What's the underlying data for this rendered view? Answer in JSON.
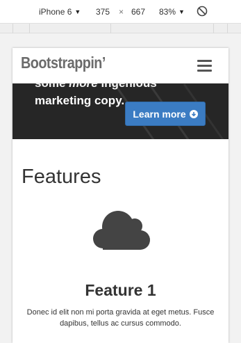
{
  "devtools": {
    "device": "iPhone 6",
    "width": "375",
    "separator": "×",
    "height": "667",
    "zoom": "83%"
  },
  "navbar": {
    "brand": "Bootstrappin’"
  },
  "hero": {
    "line1_start": "some ",
    "line1_em": "more",
    "line1_end": " ingenious",
    "line2": "marketing copy.",
    "button_label": "Learn more"
  },
  "features": {
    "heading": "Features",
    "feature1": {
      "icon": "cloud-icon",
      "title": "Feature 1",
      "description": "Donec id elit non mi porta gravida at eget metus. Fusce dapibus, tellus ac cursus commodo."
    }
  },
  "colors": {
    "accent": "#3b7cc3",
    "hero_bg": "#262626",
    "icon": "#444444"
  }
}
